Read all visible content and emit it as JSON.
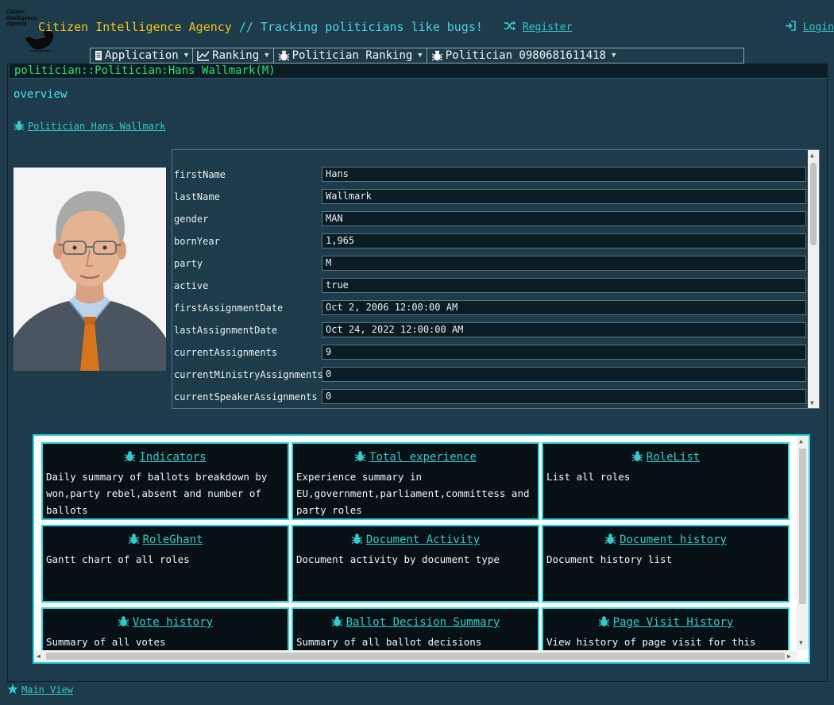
{
  "header": {
    "logo_text": [
      "Citizen",
      "Intelligence",
      "Agency"
    ],
    "title": "Citizen Intelligence Agency",
    "separator": " // ",
    "tagline": "Tracking politicians like bugs!",
    "register_label": "Register",
    "login_label": "Login"
  },
  "menu": [
    {
      "label": "Application",
      "icon": "document-icon"
    },
    {
      "label": "Ranking",
      "icon": "line-chart-icon"
    },
    {
      "label": "Politician Ranking",
      "icon": "bug-icon"
    },
    {
      "label": "Politician 0980681611418",
      "icon": "bug-icon"
    }
  ],
  "panel": {
    "title": "politician::Politician:Hans Wallmark(M)",
    "section": "overview",
    "politician_link": "Politician Hans Wallmark"
  },
  "form": {
    "fields": [
      {
        "label": "firstName",
        "value": "Hans"
      },
      {
        "label": "lastName",
        "value": "Wallmark"
      },
      {
        "label": "gender",
        "value": "MAN"
      },
      {
        "label": "bornYear",
        "value": "1,965"
      },
      {
        "label": "party",
        "value": "M"
      },
      {
        "label": "active",
        "value": "true"
      },
      {
        "label": "firstAssignmentDate",
        "value": "Oct 2, 2006 12:00:00 AM"
      },
      {
        "label": "lastAssignmentDate",
        "value": "Oct 24, 2022 12:00:00 AM"
      },
      {
        "label": "currentAssignments",
        "value": "9"
      },
      {
        "label": "currentMinistryAssignments",
        "value": "0"
      },
      {
        "label": "currentSpeakerAssignments",
        "value": "0"
      }
    ]
  },
  "cards": [
    {
      "title": "Indicators",
      "desc": "Daily summary of ballots breakdown by won,party rebel,absent and number of ballots"
    },
    {
      "title": "Total experience",
      "desc": "Experience summary in EU,government,parliament,committess and party roles"
    },
    {
      "title": "RoleList",
      "desc": "List all roles"
    },
    {
      "title": "RoleGhant",
      "desc": "Gantt chart of all roles"
    },
    {
      "title": "Document Activity",
      "desc": "Document activity by document type"
    },
    {
      "title": "Document history",
      "desc": "Document history list"
    },
    {
      "title": "Vote history",
      "desc": "Summary of all votes"
    },
    {
      "title": "Ballot Decision Summary",
      "desc": "Summary of all ballot decisions"
    },
    {
      "title": "Page Visit History",
      "desc": "View history of page visit for this page."
    }
  ],
  "footer": {
    "main_view_label": "Main View"
  },
  "colors": {
    "accent": "#28d4dc",
    "title_yellow": "#f0c419",
    "panel_title_green": "#2de06a",
    "background": "#1d3b4a"
  }
}
